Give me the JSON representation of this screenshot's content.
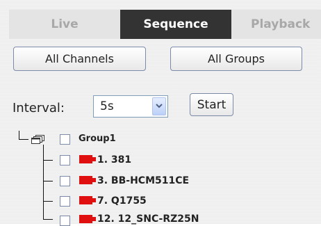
{
  "tabs": [
    {
      "label": "Live",
      "active": false
    },
    {
      "label": "Sequence",
      "active": true
    },
    {
      "label": "Playback",
      "active": false
    }
  ],
  "buttons": {
    "all_channels": "All Channels",
    "all_groups": "All Groups",
    "start": "Start"
  },
  "interval": {
    "label": "Interval:",
    "selected": "5s"
  },
  "tree": {
    "group": {
      "label": "Group1",
      "icon": "group-windows-icon",
      "checked": false
    },
    "channels": [
      {
        "label": "1. 381",
        "icon": "camera-icon",
        "checked": false
      },
      {
        "label": "3. BB-HCM511CE",
        "icon": "camera-icon",
        "checked": false
      },
      {
        "label": "7. Q1755",
        "icon": "camera-icon",
        "checked": false
      },
      {
        "label": "12. 12_SNC-RZ25N",
        "icon": "camera-icon",
        "checked": false
      }
    ]
  },
  "colors": {
    "active_tab_bg": "#333333",
    "inactive_tab_text": "#a8a8a8",
    "camera_red": "#e01010"
  }
}
